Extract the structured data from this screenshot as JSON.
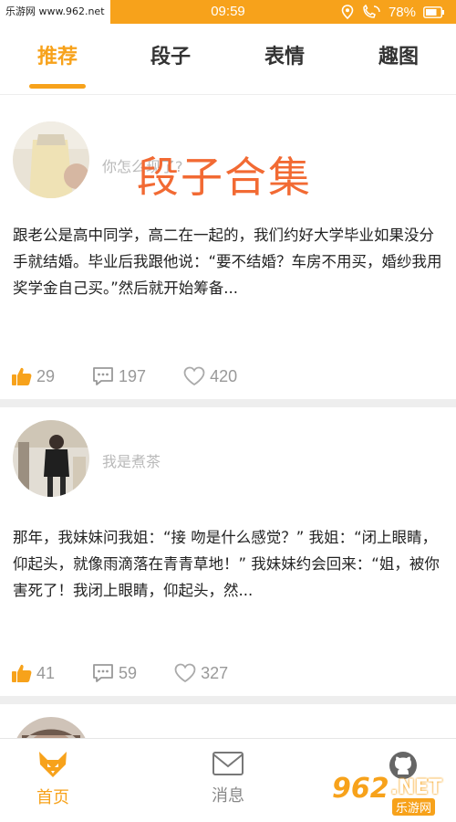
{
  "status_bar": {
    "watermark": "乐游网 www.962.net",
    "time": "09:59",
    "battery": "78%"
  },
  "tabs": [
    {
      "label": "推荐",
      "active": true
    },
    {
      "label": "段子",
      "active": false
    },
    {
      "label": "表情",
      "active": false
    },
    {
      "label": "趣图",
      "active": false
    }
  ],
  "overlay_title": "段子合集",
  "posts": [
    {
      "username": "你怎么现了?",
      "content": "跟老公是高中同学，高二在一起的，我们约好大学毕业如果没分手就结婚。毕业后我跟他说：“要不结婚？车房不用买，婚纱我用奖学金自己买。”然后就开始筹备...",
      "likes": "29",
      "comments": "197",
      "favorites": "420"
    },
    {
      "username": "我是煮茶",
      "content": "那年，我妹妹问我姐：“接 吻是什么感觉？” 我姐：“闭上眼睛，仰起头，就像雨滴落在青青草地！” 我妹妹约会回来：“姐，被你害死了！我闭上眼睛，仰起头，然...",
      "likes": "41",
      "comments": "59",
      "favorites": "327"
    }
  ],
  "bottom_nav": [
    {
      "label": "首页",
      "icon": "fox-home-icon",
      "active": true
    },
    {
      "label": "消息",
      "icon": "envelope-icon",
      "active": false
    },
    {
      "label": "",
      "icon": "github-icon",
      "active": false
    }
  ],
  "watermark_br": {
    "num": "962",
    "net": ".NET",
    "sub": "乐游网"
  },
  "colors": {
    "accent": "#f7a21b",
    "overlay": "#f26a33",
    "muted": "#999999"
  }
}
